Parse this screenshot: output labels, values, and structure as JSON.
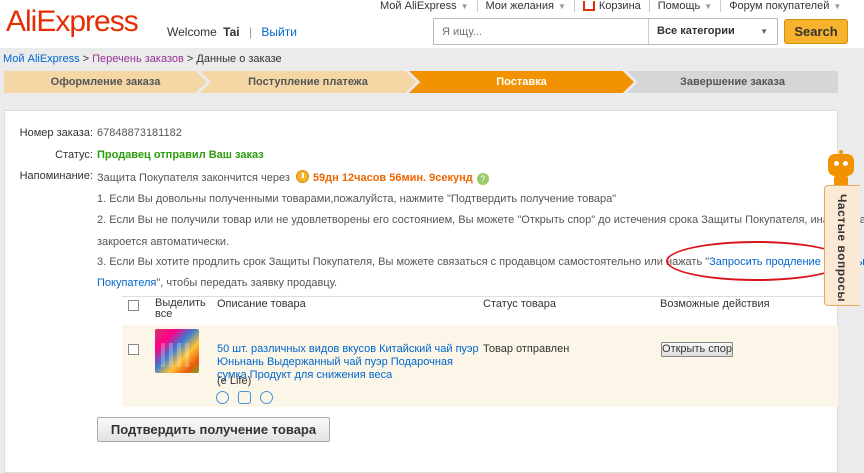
{
  "header": {
    "logo": "AliExpress",
    "welcome": "Welcome",
    "username": "Tai",
    "logout": "Выйти",
    "nav": [
      "Мой AliExpress",
      "Мои желания",
      "Корзина",
      "Помощь",
      "Форум покупателей"
    ]
  },
  "search": {
    "placeholder": "Я ищу...",
    "category": "Все категории",
    "button": "Search"
  },
  "breadcrumb": {
    "home": "Мой AliExpress",
    "orders": "Перечень заказов",
    "current": "Данные о заказе",
    "sep": ">"
  },
  "steps": [
    "Оформление заказа",
    "Поступление платежа",
    "Поставка",
    "Завершение заказа"
  ],
  "order": {
    "number_label": "Номер заказа:",
    "number": "67848873181182",
    "status_label": "Статус:",
    "status": "Продавец отправил Ваш заказ",
    "reminder_label": "Напоминание:",
    "reminder_text": "Защита Покупателя закончится через",
    "countdown": "59дн 12часов 56мин. 9секунд",
    "help": "?",
    "notes": [
      "1. Если Вы довольны полученными товарами,пожалуйста, нажмите \"Подтвердить получение товара\"",
      "2. Если Вы не получили товар или не удовлетворены его состоянием, Вы можете \"Открыть спор\" до истечения срока Защиты Покупателя, иначе заказ",
      "закроется автоматически.",
      "3. Если Вы хотите продлить срок Защиты Покупателя, Вы можете связаться с продавцом самостоятельно или нажать \""
    ],
    "extend_link_part1": "Запросить продление Защиты",
    "extend_link_part2": "Покупателя",
    "extend_tail": "\", чтобы передать заявку продавцу."
  },
  "table": {
    "col_select": "Выделить все",
    "col_desc": "Описание товара",
    "col_status": "Статус товара",
    "col_actions": "Возможные действия"
  },
  "item": {
    "title": "50 шт. различных видов вкусов Китайский чай пуэр Юньнань Выдержанный чай пуэр Подарочная сумка Продукт для снижения веса",
    "seller": "(e Life)",
    "status": "Товар отправлен",
    "action": "Открыть спор"
  },
  "confirm_button": "Подтвердить получение товара",
  "faq": "Частые вопросы",
  "colors": {
    "brand": "#e62e04",
    "active_step": "#f39200",
    "link": "#0066cc",
    "status_green": "#2a9d0b",
    "annotation_red": "#d9141c"
  }
}
